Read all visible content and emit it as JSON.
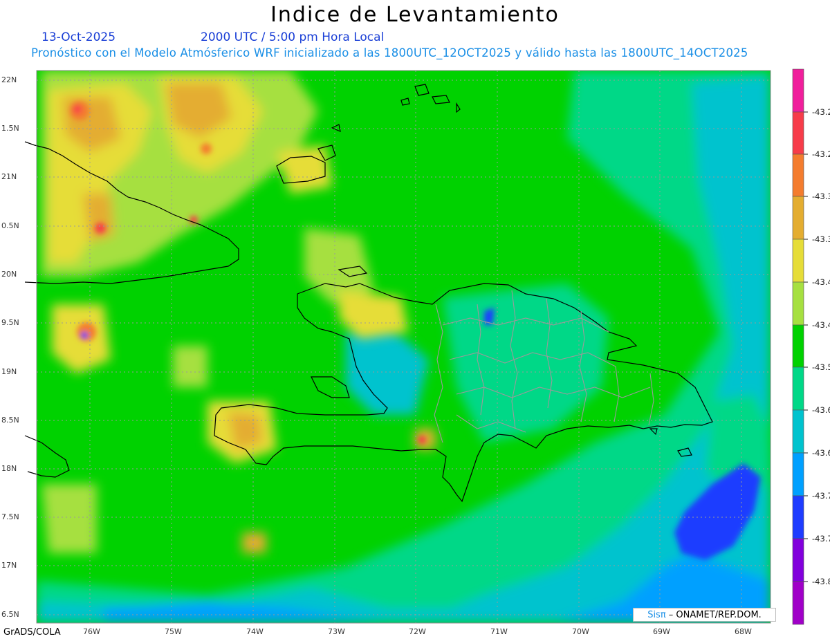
{
  "header": {
    "title": "Indice de Levantamiento",
    "date": "13-Oct-2025",
    "time": "2000 UTC / 5:00 pm Hora Local",
    "forecast": "Pronóstico con el Modelo Atmósferico WRF inicializado a las 1800UTC_12OCT2025 y válido hasta las  1800UTC_14OCT2025"
  },
  "map": {
    "lat_labels": [
      "22N",
      "1.5N",
      "21N",
      "0.5N",
      "20N",
      "9.5N",
      "19N",
      "8.5N",
      "18N",
      "7.5N",
      "17N",
      "6.5N"
    ],
    "lon_labels": [
      "76W",
      "75W",
      "74W",
      "73W",
      "72W",
      "71W",
      "70W",
      "69W",
      "68W"
    ]
  },
  "colorbar": {
    "labels": [
      "-43.2",
      "-43.2",
      "-43.3",
      "-43.3",
      "-43.4",
      "-43.4",
      "-43.5",
      "-43.6",
      "-43.6",
      "-43.7",
      "-43.7",
      "-43.8"
    ],
    "colors": [
      "#f01e9c",
      "#f73c4a",
      "#f47c2e",
      "#e4ad30",
      "#e6dd38",
      "#a6e040",
      "#00d200",
      "#00d887",
      "#00c3ce",
      "#00a0ff",
      "#1e3cff",
      "#8200dc",
      "#a000c8"
    ]
  },
  "credit": {
    "sis": "Sisπ",
    "text": " – ONAMET/REP.DOM."
  },
  "footer": "GrADS/COLA"
}
